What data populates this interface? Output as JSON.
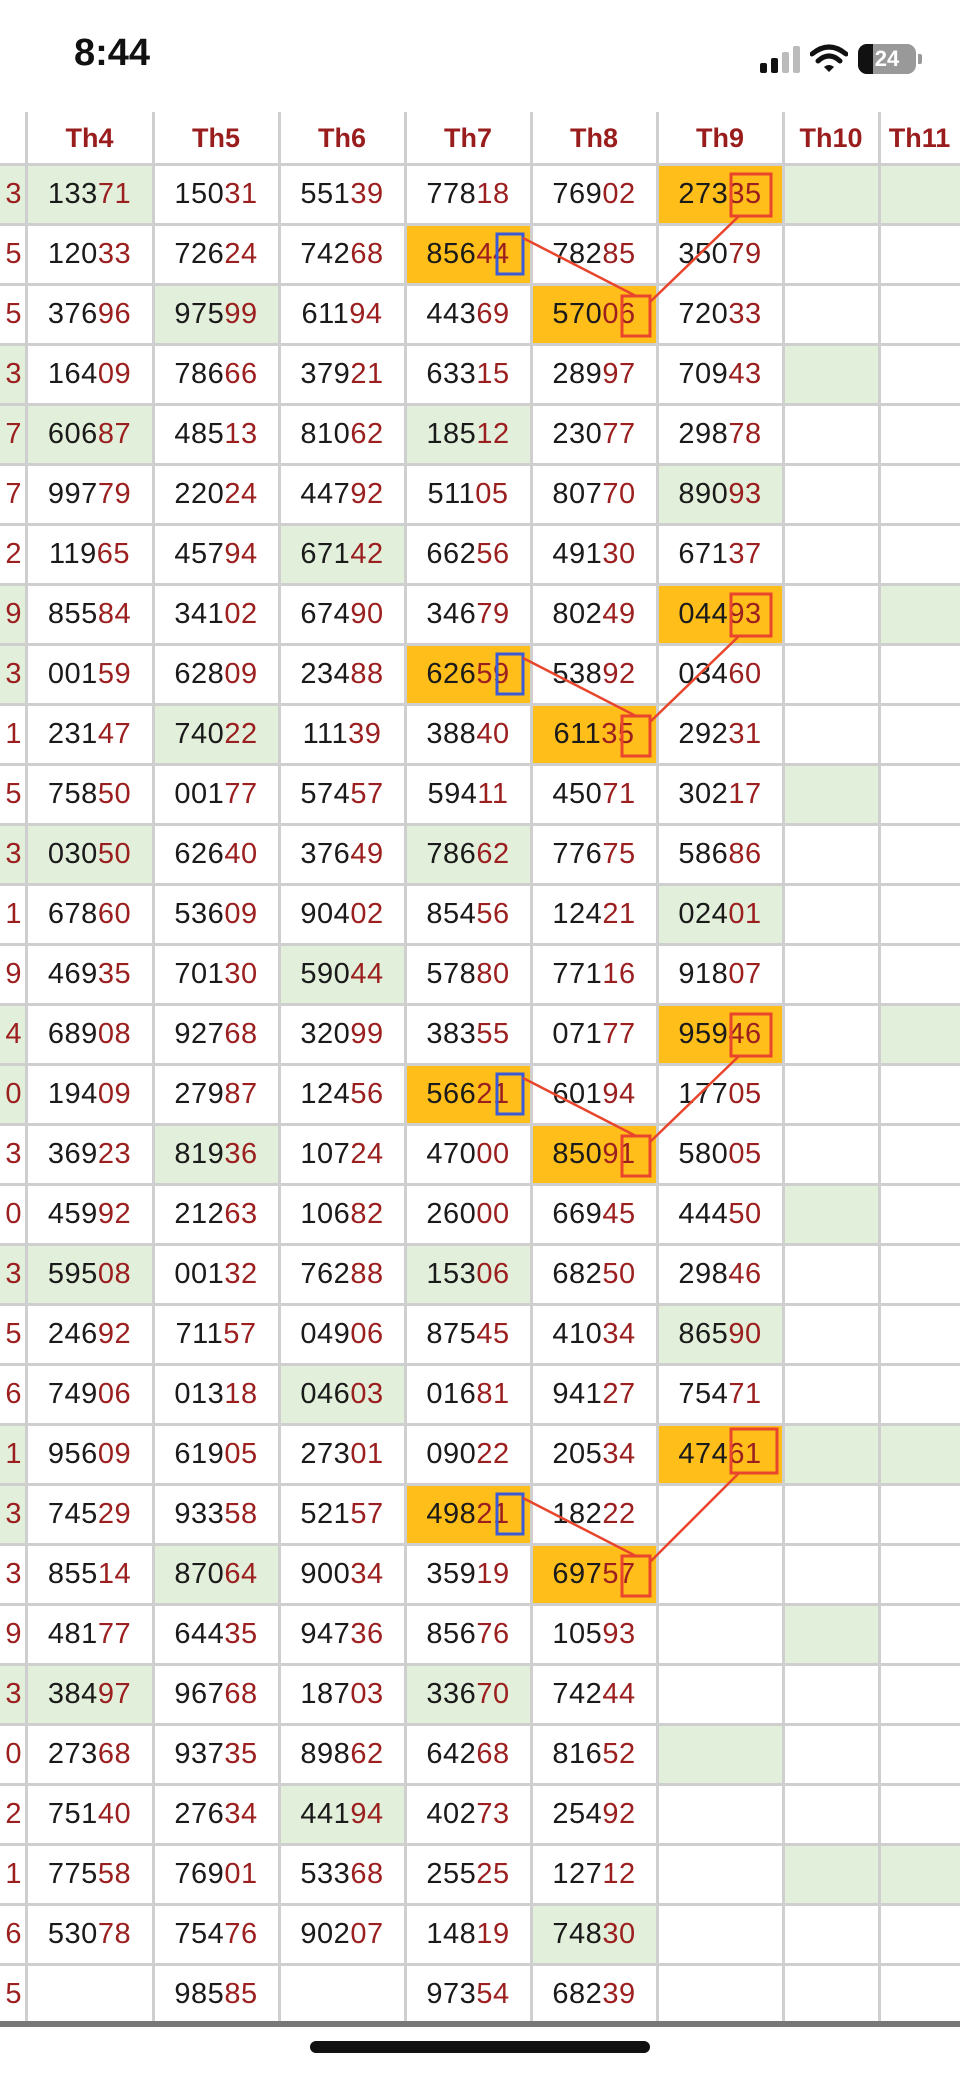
{
  "status_bar": {
    "time": "8:44",
    "battery": "24"
  },
  "columns": [
    "",
    "Th4",
    "Th5",
    "Th6",
    "Th7",
    "Th8",
    "Th9",
    "Th10",
    "Th11"
  ],
  "left_edge": [
    "3",
    "5",
    "5",
    "3",
    "7",
    "7",
    "2",
    "9",
    "3",
    "1",
    "5",
    "3",
    "1",
    "9",
    "4",
    "0",
    "3",
    "0",
    "3",
    "5",
    "6",
    "1",
    "3",
    "3",
    "9",
    "3",
    "0",
    "2",
    "1",
    "6",
    "5"
  ],
  "rows": [
    [
      "13371",
      "15031",
      "55139",
      "77818",
      "76902",
      "27335"
    ],
    [
      "12033",
      "72624",
      "74268",
      "85644",
      "78285",
      "35079"
    ],
    [
      "37696",
      "97599",
      "61194",
      "44369",
      "57006",
      "72033"
    ],
    [
      "16409",
      "78666",
      "37921",
      "63315",
      "28997",
      "70943"
    ],
    [
      "60687",
      "48513",
      "81062",
      "18512",
      "23077",
      "29878"
    ],
    [
      "99779",
      "22024",
      "44792",
      "51105",
      "80770",
      "89093"
    ],
    [
      "11965",
      "45794",
      "67142",
      "66256",
      "49130",
      "67137"
    ],
    [
      "85584",
      "34102",
      "67490",
      "34679",
      "80249",
      "04493"
    ],
    [
      "00159",
      "62809",
      "23488",
      "62659",
      "53892",
      "03460"
    ],
    [
      "23147",
      "74022",
      "11139",
      "38840",
      "61135",
      "29231"
    ],
    [
      "75850",
      "00177",
      "57457",
      "59411",
      "45071",
      "30217"
    ],
    [
      "03050",
      "62640",
      "37649",
      "78662",
      "77675",
      "58686"
    ],
    [
      "67860",
      "53609",
      "90402",
      "85456",
      "12421",
      "02401"
    ],
    [
      "46935",
      "70130",
      "59044",
      "57880",
      "77116",
      "91807"
    ],
    [
      "68908",
      "92768",
      "32099",
      "38355",
      "07177",
      "95946"
    ],
    [
      "19409",
      "27987",
      "12456",
      "56621",
      "60194",
      "17705"
    ],
    [
      "36923",
      "81936",
      "10724",
      "47000",
      "85091",
      "58005"
    ],
    [
      "45992",
      "21263",
      "10682",
      "26000",
      "66945",
      "44450"
    ],
    [
      "59508",
      "00132",
      "76288",
      "15306",
      "68250",
      "29846"
    ],
    [
      "24692",
      "71157",
      "04906",
      "87545",
      "41034",
      "86590"
    ],
    [
      "74906",
      "01318",
      "04603",
      "01681",
      "94127",
      "75471"
    ],
    [
      "95609",
      "61905",
      "27301",
      "09022",
      "20534",
      "47461"
    ],
    [
      "74529",
      "93358",
      "52157",
      "49821",
      "18222",
      ""
    ],
    [
      "85514",
      "87064",
      "90034",
      "35919",
      "69757",
      ""
    ],
    [
      "48177",
      "64435",
      "94736",
      "85676",
      "10593",
      ""
    ],
    [
      "38497",
      "96768",
      "18703",
      "33670",
      "74244",
      ""
    ],
    [
      "27368",
      "93735",
      "89862",
      "64268",
      "81652",
      ""
    ],
    [
      "75140",
      "27634",
      "44194",
      "40273",
      "25492",
      ""
    ],
    [
      "77558",
      "76901",
      "53368",
      "25525",
      "12712",
      ""
    ],
    [
      "53078",
      "75476",
      "90207",
      "14819",
      "74830",
      ""
    ],
    [
      "",
      "98585",
      "",
      "97354",
      "68239",
      ""
    ]
  ],
  "colors": {
    "header_text": "#9a1d1d",
    "tail_digits": "#9c1f1f",
    "green_cell": "#e2f0db",
    "orange_cell": "#ffbe1a",
    "red_marker": "#e8452c",
    "blue_marker": "#3a5bd9"
  }
}
